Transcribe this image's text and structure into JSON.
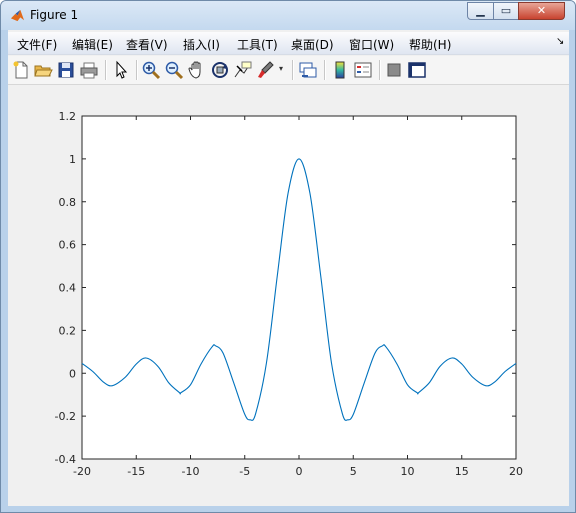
{
  "window": {
    "title": "Figure 1"
  },
  "menu": {
    "items": [
      {
        "name": "menu-file",
        "label": "文件(F)"
      },
      {
        "name": "menu-edit",
        "label": "编辑(E)"
      },
      {
        "name": "menu-view",
        "label": "查看(V)"
      },
      {
        "name": "menu-insert",
        "label": "插入(I)"
      },
      {
        "name": "menu-tools",
        "label": "工具(T)"
      },
      {
        "name": "menu-desktop",
        "label": "桌面(D)"
      },
      {
        "name": "menu-window",
        "label": "窗口(W)"
      },
      {
        "name": "menu-help",
        "label": "帮助(H)"
      }
    ]
  },
  "toolbar": {
    "buttons": [
      "new-figure-icon",
      "open-file-icon",
      "save-icon",
      "print-icon",
      "edit-plot-icon",
      "zoom-in-icon",
      "zoom-out-icon",
      "pan-icon",
      "rotate-3d-icon",
      "data-cursor-icon",
      "brush-icon",
      "link-plot-icon",
      "colorbar-icon",
      "legend-icon",
      "hide-plot-tools-icon",
      "show-plot-tools-icon"
    ]
  },
  "colors": {
    "line": "#0072bd",
    "axes_bg": "#ffffff",
    "figure_bg": "#f0f0f0"
  },
  "chart_data": {
    "type": "line",
    "function": "sin(x)/x",
    "title": "",
    "xlabel": "",
    "ylabel": "",
    "xlim": [
      -20,
      20
    ],
    "ylim": [
      -0.4,
      1.2
    ],
    "xticks": [
      -20,
      -15,
      -10,
      -5,
      0,
      5,
      10,
      15,
      20
    ],
    "yticks": [
      -0.4,
      -0.2,
      0,
      0.2,
      0.4,
      0.6,
      0.8,
      1,
      1.2
    ],
    "xtick_labels": [
      "-20",
      "-15",
      "-10",
      "-5",
      "0",
      "5",
      "10",
      "15",
      "20"
    ],
    "ytick_labels": [
      "-0.4",
      "-0.2",
      "0",
      "0.2",
      "0.4",
      "0.6",
      "0.8",
      "1",
      "1.2"
    ],
    "series": [
      {
        "x": [
          -20,
          -19,
          -18,
          -17.2,
          -16,
          -15,
          -14.1,
          -13,
          -12,
          -11,
          -10.9,
          -10,
          -9,
          -8,
          -7.7,
          -7,
          -6,
          -5,
          -4.5,
          -4,
          -3,
          -2,
          -1,
          0,
          1,
          2,
          3,
          4,
          4.5,
          5,
          6,
          7,
          7.7,
          8,
          9,
          10,
          10.9,
          11,
          12,
          13,
          14.1,
          15,
          16,
          17.2,
          18,
          19,
          20
        ],
        "y": [
          0.046,
          0.008,
          -0.042,
          -0.058,
          -0.018,
          0.043,
          0.071,
          0.032,
          -0.045,
          -0.091,
          -0.091,
          -0.054,
          0.046,
          0.124,
          0.128,
          0.094,
          -0.047,
          -0.192,
          -0.217,
          -0.189,
          0.047,
          0.455,
          0.841,
          1.0,
          0.841,
          0.455,
          0.047,
          -0.189,
          -0.217,
          -0.192,
          -0.047,
          0.094,
          0.128,
          0.124,
          0.046,
          -0.054,
          -0.091,
          -0.091,
          -0.045,
          0.032,
          0.071,
          0.043,
          -0.018,
          -0.058,
          -0.042,
          0.008,
          0.046
        ]
      }
    ],
    "grid": false,
    "legend": "none"
  }
}
